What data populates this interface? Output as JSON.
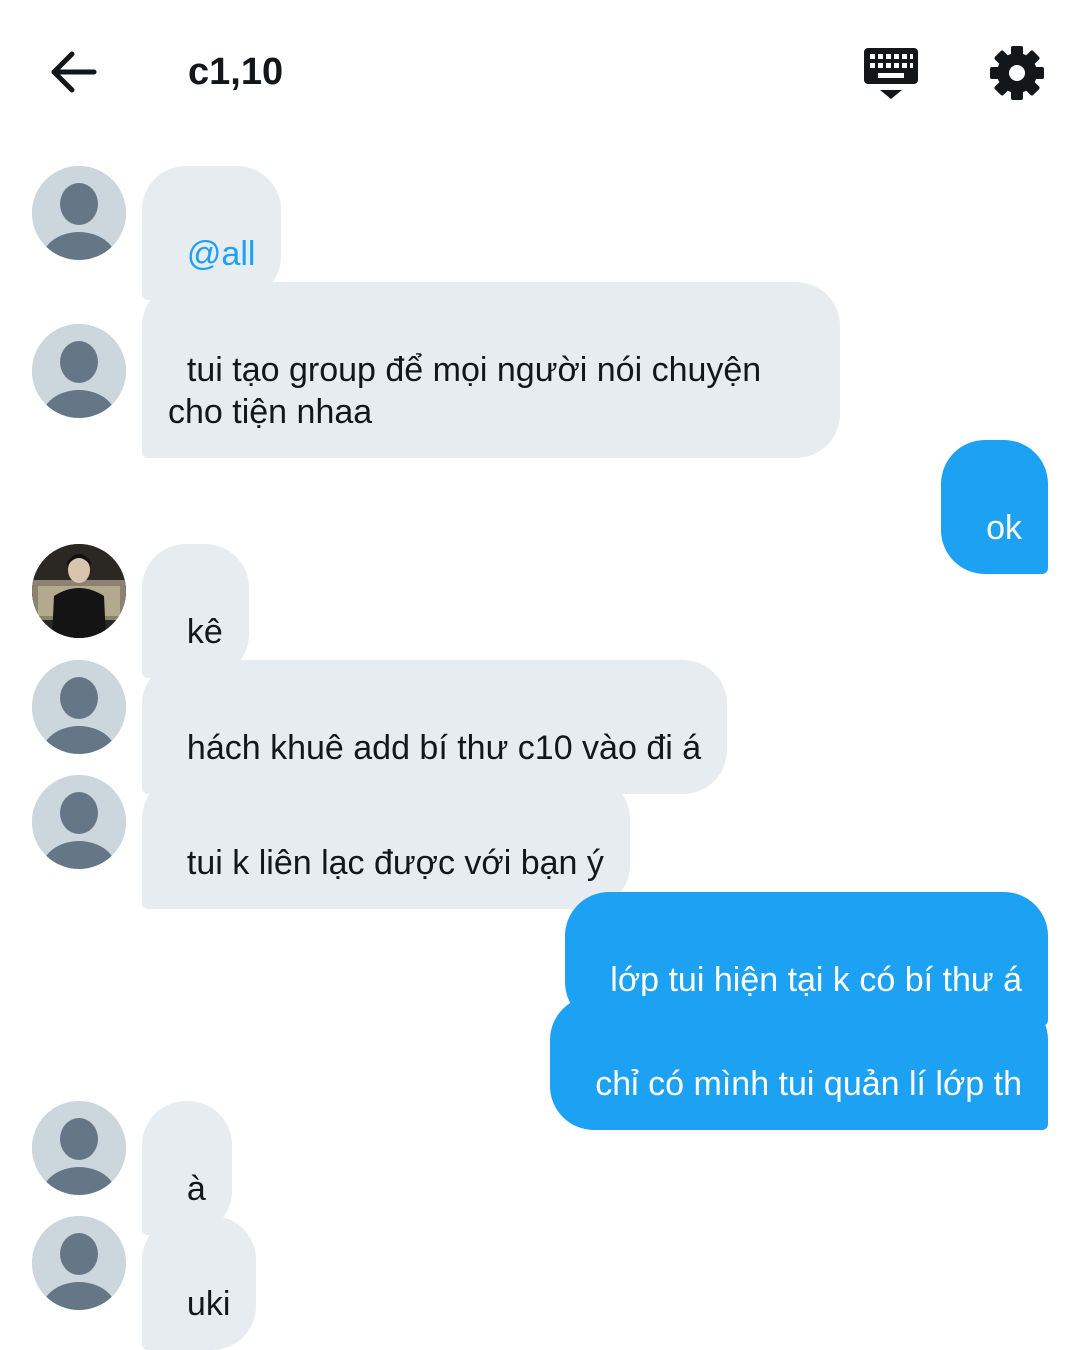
{
  "header": {
    "title": "c1,10",
    "back_icon": "arrow-left-icon",
    "keyboard_icon": "keyboard-hide-icon",
    "settings_icon": "gear-icon"
  },
  "colors": {
    "incoming_bubble": "#e6ecf0",
    "outgoing_bubble": "#1da1f2",
    "mention": "#1da1f2",
    "avatar_placeholder": "#ccd6dd",
    "avatar_figure": "#657786"
  },
  "messages": [
    {
      "direction": "incoming",
      "avatar": "default",
      "text": "@all"
    },
    {
      "direction": "incoming",
      "avatar": "default",
      "text": "tui tạo group để mọi người nói chuyện\ncho tiện nhaa"
    },
    {
      "direction": "outgoing",
      "text": "ok"
    },
    {
      "direction": "incoming",
      "avatar": "photo",
      "text": "kê"
    },
    {
      "direction": "incoming",
      "avatar": "default",
      "text": "hách khuê add bí thư c10 vào đi á"
    },
    {
      "direction": "incoming",
      "avatar": "default",
      "text": "tui k liên lạc được với bạn ý"
    },
    {
      "direction": "outgoing",
      "text": "lớp tui hiện tại k có bí thư á"
    },
    {
      "direction": "outgoing",
      "text": "chỉ có mình tui quản lí lớp th"
    },
    {
      "direction": "incoming",
      "avatar": "default",
      "text": "à"
    },
    {
      "direction": "incoming",
      "avatar": "default",
      "text": "uki"
    }
  ]
}
